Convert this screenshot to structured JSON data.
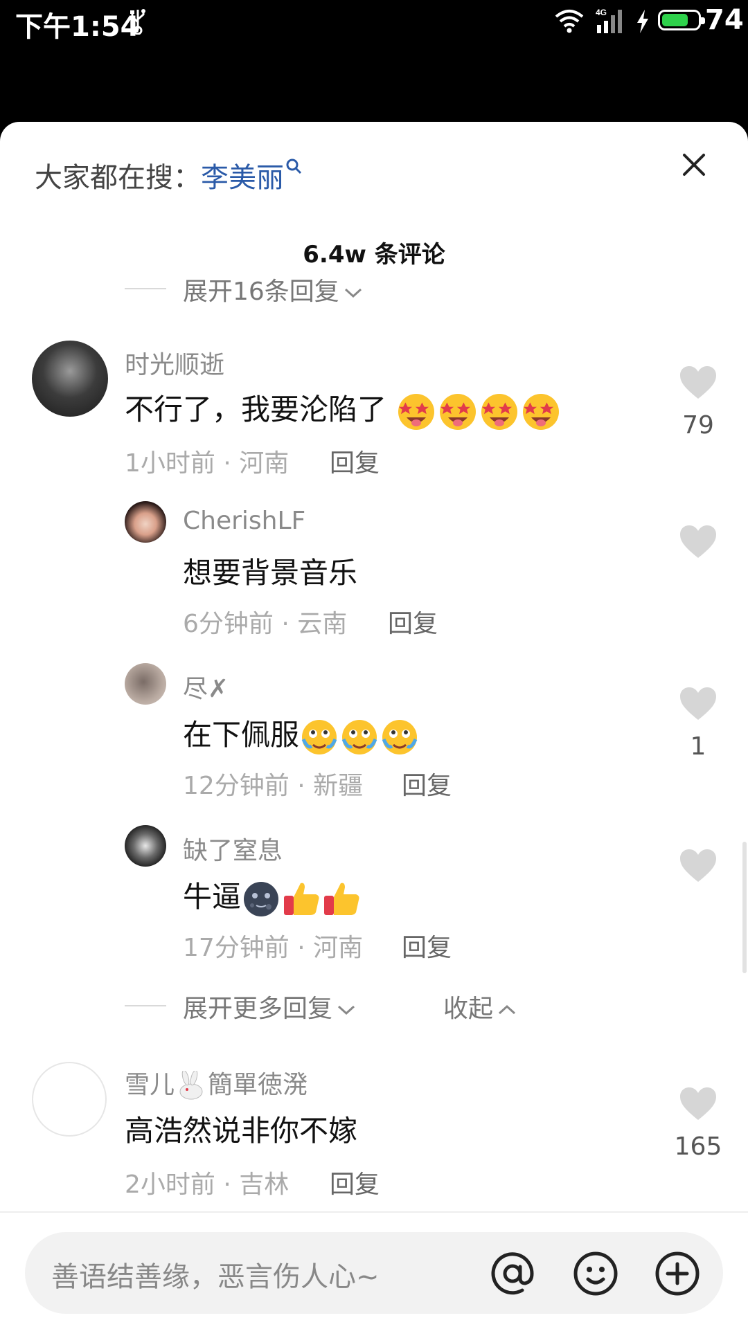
{
  "status_bar": {
    "time": "下午1:54",
    "battery": "74",
    "battery_level": 0.74,
    "network": "4G"
  },
  "header": {
    "hot_search_prefix": "大家都在搜：",
    "hot_search_keyword": "李美丽",
    "comment_count": "6.4w 条评论"
  },
  "expand_top": "展开16条回复",
  "comments": [
    {
      "user": "时光顺逝",
      "text": "不行了，我要沦陷了",
      "time_loc": "1小时前 · 河南",
      "reply": "回复",
      "likes": "79",
      "emoji": "star-struck-face"
    },
    {
      "user": "CherishLF",
      "text": "想要背景音乐",
      "time_loc": "6分钟前 · 云南",
      "reply": "回复",
      "likes": ""
    },
    {
      "user": "尽✗",
      "text": "在下佩服",
      "time_loc": "12分钟前 · 新疆",
      "reply": "回复",
      "likes": "1",
      "emoji": "tearful-face"
    },
    {
      "user": "缺了窒息",
      "text": "牛逼",
      "time_loc": "17分钟前 · 河南",
      "reply": "回复",
      "likes": "",
      "emoji": "dark-moon-face, thumbs-up"
    },
    {
      "user_a": "雪儿",
      "user_b": "簡單徳溌",
      "text": "高浩然说非你不嫁",
      "time_loc": "2小时前 · 吉林",
      "reply": "回复",
      "likes": "165",
      "user_icon": "rabbit-emoji"
    }
  ],
  "expand_more": "展开更多回复",
  "collapse": "收起",
  "input": {
    "placeholder": "善语结善缘，恶言伤人心~"
  },
  "colors": {
    "keyword": "#2a5aa8",
    "heart": "#d6d6d6",
    "battery_fill": "#2ed14b"
  }
}
